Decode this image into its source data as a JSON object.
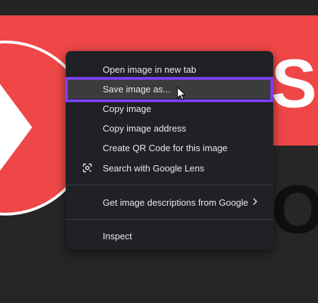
{
  "background": {
    "big_text_top": "Sc",
    "big_text_bottom": "O",
    "colors": {
      "red": "#ef4747",
      "dark": "#262626",
      "white": "#ffffff"
    }
  },
  "context_menu": {
    "items": [
      {
        "label": "Open image in new tab",
        "icon": null
      },
      {
        "label": "Save image as...",
        "icon": null,
        "highlighted": true
      },
      {
        "label": "Copy image",
        "icon": null
      },
      {
        "label": "Copy image address",
        "icon": null
      },
      {
        "label": "Create QR Code for this image",
        "icon": null
      },
      {
        "label": "Search with Google Lens",
        "icon": "google-lens-icon"
      }
    ],
    "group2": [
      {
        "label": "Get image descriptions from Google",
        "icon": "chevron-right-icon"
      }
    ],
    "group3": [
      {
        "label": "Inspect",
        "icon": null
      }
    ],
    "colors": {
      "menu_bg": "#202124",
      "text": "#e8eaed",
      "highlight_bg": "#3c3c3c",
      "frame": "#7b3ff2"
    }
  }
}
